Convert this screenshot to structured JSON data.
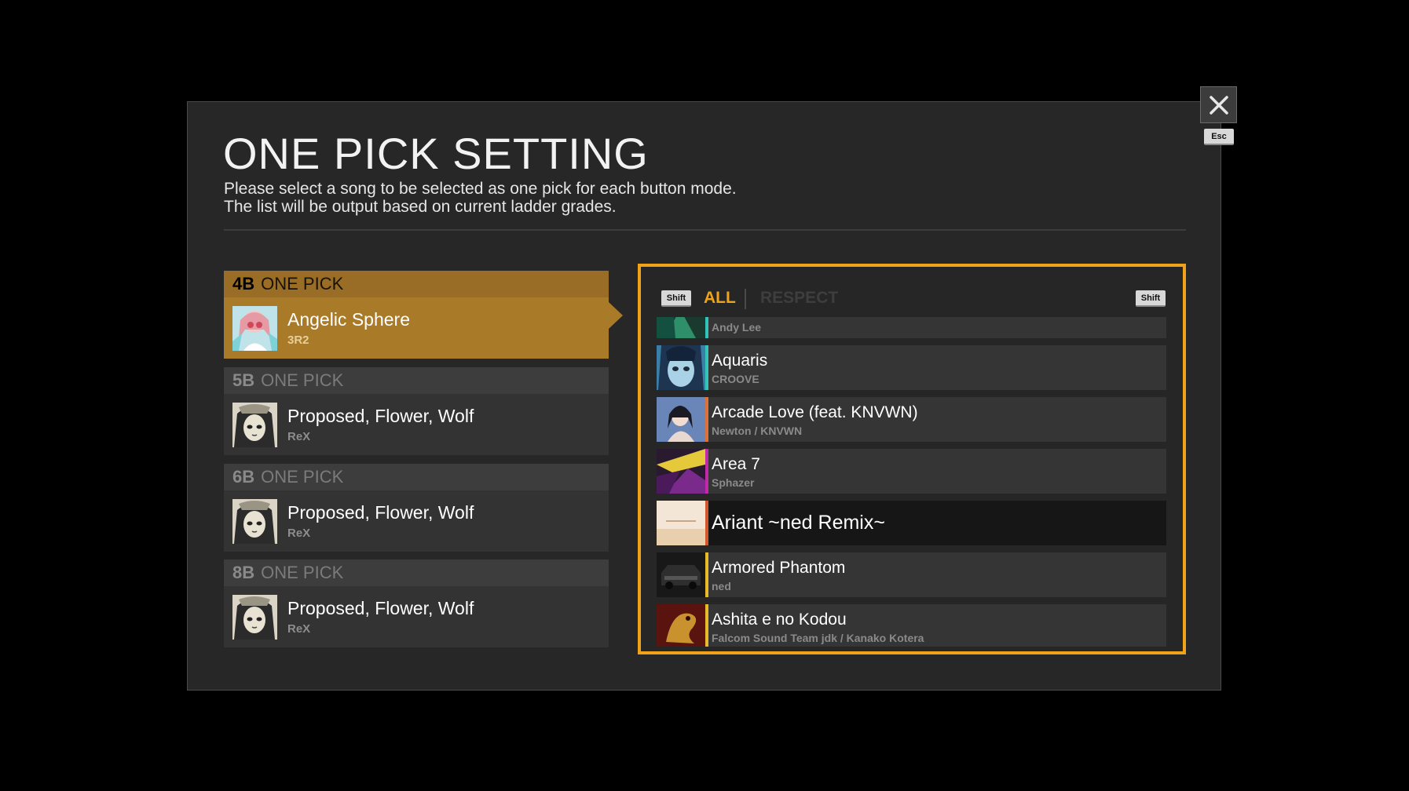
{
  "dialog": {
    "title": "ONE PICK SETTING",
    "description_line1": "Please select a song to be selected as one pick for each button mode.",
    "description_line2": "The list will be output based on current ladder grades.",
    "esc_label": "Esc"
  },
  "picks": [
    {
      "mode": "4B",
      "label": "ONE PICK",
      "song": "Angelic Sphere",
      "artist": "3R2",
      "active": true
    },
    {
      "mode": "5B",
      "label": "ONE PICK",
      "song": "Proposed, Flower, Wolf",
      "artist": "ReX",
      "active": false
    },
    {
      "mode": "6B",
      "label": "ONE PICK",
      "song": "Proposed, Flower, Wolf",
      "artist": "ReX",
      "active": false
    },
    {
      "mode": "8B",
      "label": "ONE PICK",
      "song": "Proposed, Flower, Wolf",
      "artist": "ReX",
      "active": false
    }
  ],
  "song_list": {
    "shift_label": "Shift",
    "tabs": {
      "all": "ALL",
      "respect": "RESPECT"
    },
    "partial_top_artist": "Andy Lee",
    "rows": [
      {
        "song": "Aquaris",
        "artist": "CROOVE",
        "accent": "#34c3b8"
      },
      {
        "song": "Arcade Love (feat. KNVWN)",
        "artist": "Newton / KNVWN",
        "accent": "#e0703a"
      },
      {
        "song": "Area 7",
        "artist": "Sphazer",
        "accent": "#c02aa8"
      },
      {
        "song": "Ariant ~ned Remix~",
        "artist": "",
        "accent": "#d0582a",
        "selected": true
      },
      {
        "song": "Armored Phantom",
        "artist": "ned",
        "accent": "#e8b92a"
      },
      {
        "song": "Ashita e no Kodou",
        "artist": "Falcom Sound Team jdk / Kanako Kotera",
        "accent": "#e8b92a"
      }
    ]
  },
  "colors": {
    "accent": "#f0a21a",
    "active_pick": "#a97a27"
  }
}
